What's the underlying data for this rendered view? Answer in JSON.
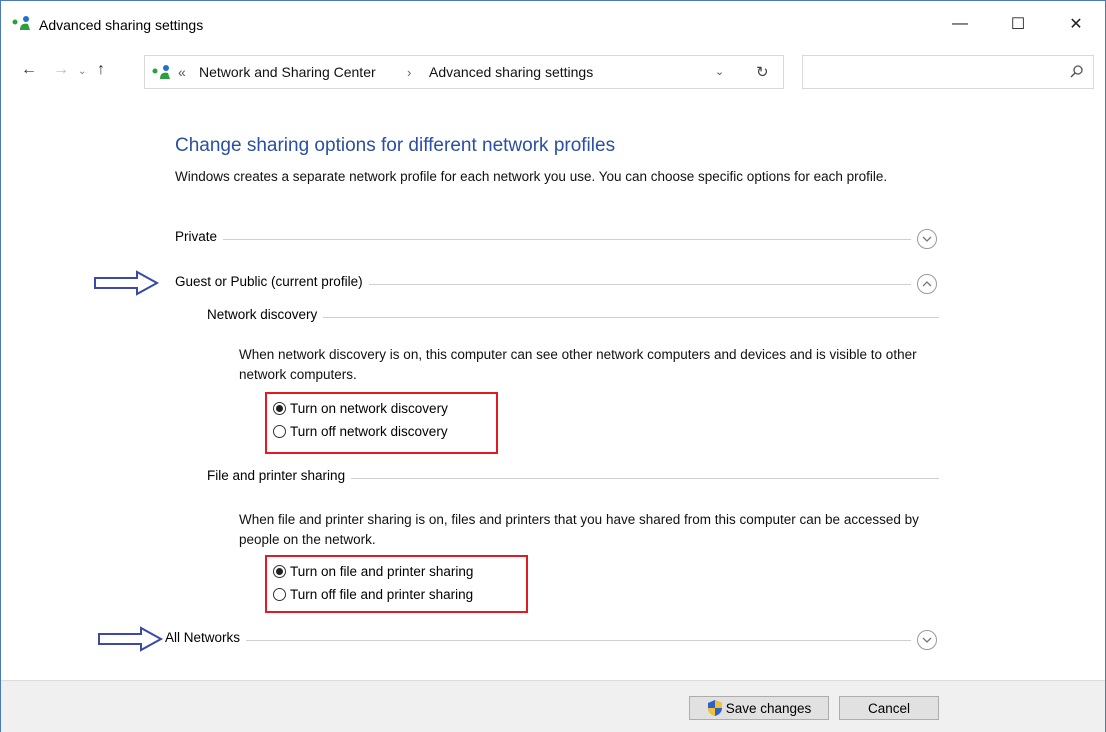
{
  "window": {
    "title": "Advanced sharing settings",
    "controls": {
      "minimize": "—",
      "maximize": "☐",
      "close": "✕"
    }
  },
  "nav": {
    "back": "←",
    "forward": "→",
    "recent": "⌄",
    "up": "↑"
  },
  "address": {
    "separator_start": "«",
    "crumbs": [
      "Network and Sharing Center",
      "Advanced sharing settings"
    ],
    "separator": "›",
    "dropdown": "⌄",
    "refresh": "↻"
  },
  "search": {
    "placeholder": ""
  },
  "content": {
    "heading": "Change sharing options for different network profiles",
    "intro": "Windows creates a separate network profile for each network you use. You can choose specific options for each profile.",
    "profiles": {
      "private": {
        "label": "Private",
        "expanded": false
      },
      "guest": {
        "label": "Guest or Public (current profile)",
        "expanded": true
      },
      "all": {
        "label": "All Networks",
        "expanded": false
      }
    },
    "network_discovery": {
      "label": "Network discovery",
      "description": "When network discovery is on, this computer can see other network computers and devices and is visible to other network computers.",
      "options": [
        {
          "label": "Turn on network discovery",
          "selected": true
        },
        {
          "label": "Turn off network discovery",
          "selected": false
        }
      ]
    },
    "file_printer_sharing": {
      "label": "File and printer sharing",
      "description": "When file and printer sharing is on, files and printers that you have shared from this computer can be accessed by people on the network.",
      "options": [
        {
          "label": "Turn on file and printer sharing",
          "selected": true
        },
        {
          "label": "Turn off file and printer sharing",
          "selected": false
        }
      ]
    }
  },
  "footer": {
    "save_label": "Save changes",
    "cancel_label": "Cancel"
  },
  "colors": {
    "heading": "#2a4fa3",
    "highlight_box": "#e01b24",
    "annotation_arrow": "#3b4aa8",
    "window_border": "#4a7ab8"
  }
}
